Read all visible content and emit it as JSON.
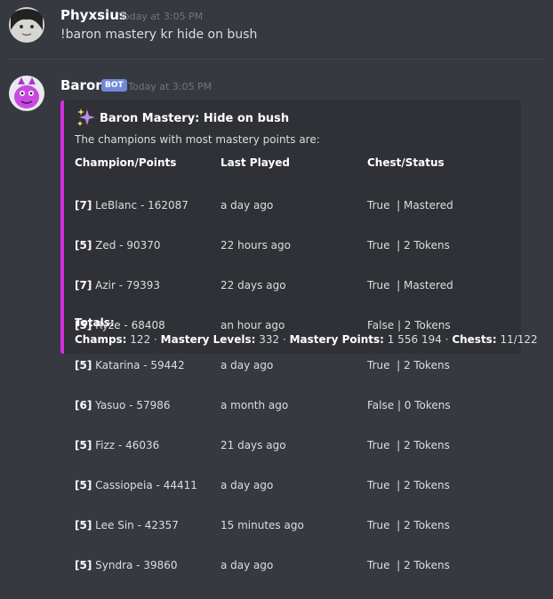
{
  "message1": {
    "username": "Phyxsius",
    "timestamp": "Today at 3:05 PM",
    "text": "!baron mastery kr hide on bush"
  },
  "message2": {
    "username": "Baron",
    "bot_tag": "BOT",
    "timestamp": "Today at 3:05 PM",
    "embed": {
      "accent_color": "#d62ee5",
      "icon": "sparkles-icon",
      "title": "Baron Mastery: Hide on bush",
      "description": "The champions with most mastery points are:",
      "headers": {
        "champion": "Champion/Points",
        "last_played": "Last Played",
        "chest": "Chest/Status"
      },
      "rows": [
        {
          "level": "[7]",
          "champion": " LeBlanc - 162087",
          "last_played": "a day ago",
          "chest": "True  | Mastered"
        },
        {
          "level": "[5]",
          "champion": " Zed - 90370",
          "last_played": "22 hours ago",
          "chest": "True  | 2 Tokens"
        },
        {
          "level": "[7]",
          "champion": " Azir - 79393",
          "last_played": "22 days ago",
          "chest": "True  | Mastered"
        },
        {
          "level": "[5]",
          "champion": " Ryze - 68408",
          "last_played": "an hour ago",
          "chest": "False | 2 Tokens"
        },
        {
          "level": "[5]",
          "champion": " Katarina - 59442",
          "last_played": "a day ago",
          "chest": "True  | 2 Tokens"
        },
        {
          "level": "[6]",
          "champion": " Yasuo - 57986",
          "last_played": "a month ago",
          "chest": "False | 0 Tokens"
        },
        {
          "level": "[5]",
          "champion": " Fizz - 46036",
          "last_played": "21 days ago",
          "chest": "True  | 2 Tokens"
        },
        {
          "level": "[5]",
          "champion": " Cassiopeia - 44411",
          "last_played": "a day ago",
          "chest": "True  | 2 Tokens"
        },
        {
          "level": "[5]",
          "champion": " Lee Sin - 42357",
          "last_played": "15 minutes ago",
          "chest": "True  | 2 Tokens"
        },
        {
          "level": "[5]",
          "champion": " Syndra - 39860",
          "last_played": "a day ago",
          "chest": "True  | 2 Tokens"
        }
      ],
      "totals_label": "Totals:",
      "totals": {
        "champs_label": "Champs:",
        "champs_value": " 122 · ",
        "levels_label": "Mastery Levels:",
        "levels_value": " 332 · ",
        "points_label": "Mastery Points:",
        "points_value": " 1 556 194  · ",
        "chests_label": "Chests:",
        "chests_value": " 11/122"
      }
    }
  }
}
